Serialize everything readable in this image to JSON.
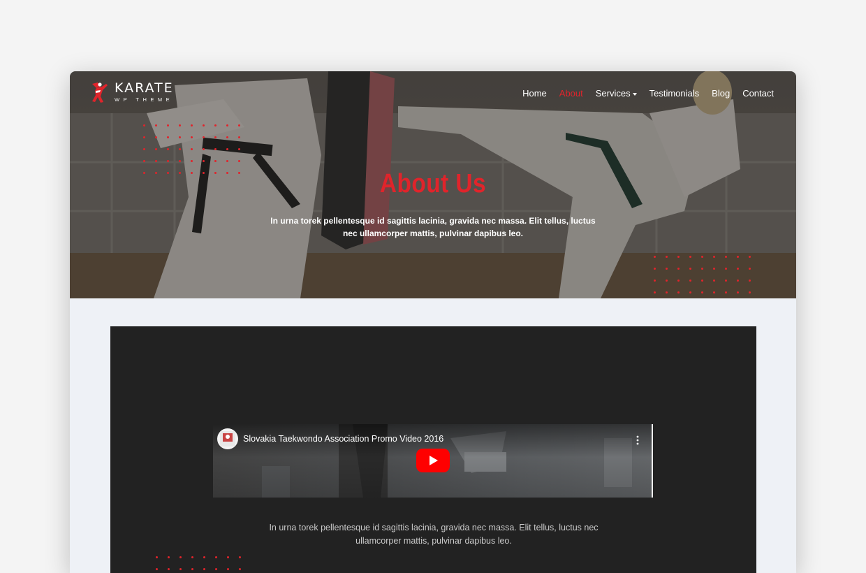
{
  "logo": {
    "word": "KARATE",
    "sub": "WP THEME"
  },
  "nav": [
    {
      "label": "Home",
      "active": false
    },
    {
      "label": "About",
      "active": true
    },
    {
      "label": "Services",
      "active": false,
      "has_dropdown": true
    },
    {
      "label": "Testimonials",
      "active": false
    },
    {
      "label": "Blog",
      "active": false
    },
    {
      "label": "Contact",
      "active": false
    }
  ],
  "hero": {
    "title": "About Us",
    "text": "In urna torek pellentesque id sagittis lacinia, gravida nec massa. Elit tellus, luctus nec ullamcorper mattis, pulvinar dapibus leo."
  },
  "video": {
    "title": "Slovakia Taekwondo Association Promo Video 2016",
    "icons": [
      "channel-avatar",
      "more-vert-icon",
      "youtube-play-icon"
    ]
  },
  "content": {
    "text": "In urna torek pellentesque id sagittis lacinia, gravida nec massa. Elit tellus, luctus nec ullamcorper mattis, pulvinar dapibus leo."
  },
  "colors": {
    "accent": "#e0242b",
    "dark_panel": "#222222",
    "page_bg": "#f4f4f4",
    "section_bg": "#eef1f6"
  }
}
